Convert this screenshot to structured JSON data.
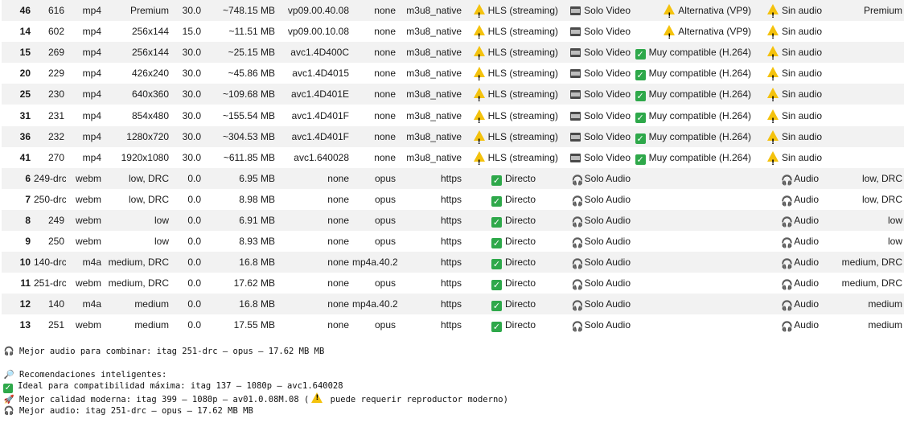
{
  "rows": [
    {
      "num": "46",
      "itag": "616",
      "ext": "mp4",
      "res": "Premium",
      "fps": "30.0",
      "size": "~748.15 MB",
      "vcodec": "vp09.00.40.08",
      "acodec": "none",
      "proto": "m3u8_native",
      "prot_icon": "warning",
      "prot": "HLS (streaming)",
      "type_icon": "film",
      "type": "Solo Video",
      "compat_icon": "warning",
      "compat": "Alternativa (VP9)",
      "audio_icon": "warning",
      "audio": "Sin audio",
      "note": "Premium"
    },
    {
      "num": "14",
      "itag": "602",
      "ext": "mp4",
      "res": "256x144",
      "fps": "15.0",
      "size": "~11.51 MB",
      "vcodec": "vp09.00.10.08",
      "acodec": "none",
      "proto": "m3u8_native",
      "prot_icon": "warning",
      "prot": "HLS (streaming)",
      "type_icon": "film",
      "type": "Solo Video",
      "compat_icon": "warning",
      "compat": "Alternativa (VP9)",
      "audio_icon": "warning",
      "audio": "Sin audio",
      "note": ""
    },
    {
      "num": "15",
      "itag": "269",
      "ext": "mp4",
      "res": "256x144",
      "fps": "30.0",
      "size": "~25.15 MB",
      "vcodec": "avc1.4D400C",
      "acodec": "none",
      "proto": "m3u8_native",
      "prot_icon": "warning",
      "prot": "HLS (streaming)",
      "type_icon": "film",
      "type": "Solo Video",
      "compat_icon": "check",
      "compat": "Muy compatible (H.264)",
      "audio_icon": "warning",
      "audio": "Sin audio",
      "note": ""
    },
    {
      "num": "20",
      "itag": "229",
      "ext": "mp4",
      "res": "426x240",
      "fps": "30.0",
      "size": "~45.86 MB",
      "vcodec": "avc1.4D4015",
      "acodec": "none",
      "proto": "m3u8_native",
      "prot_icon": "warning",
      "prot": "HLS (streaming)",
      "type_icon": "film",
      "type": "Solo Video",
      "compat_icon": "check",
      "compat": "Muy compatible (H.264)",
      "audio_icon": "warning",
      "audio": "Sin audio",
      "note": ""
    },
    {
      "num": "25",
      "itag": "230",
      "ext": "mp4",
      "res": "640x360",
      "fps": "30.0",
      "size": "~109.68 MB",
      "vcodec": "avc1.4D401E",
      "acodec": "none",
      "proto": "m3u8_native",
      "prot_icon": "warning",
      "prot": "HLS (streaming)",
      "type_icon": "film",
      "type": "Solo Video",
      "compat_icon": "check",
      "compat": "Muy compatible (H.264)",
      "audio_icon": "warning",
      "audio": "Sin audio",
      "note": ""
    },
    {
      "num": "31",
      "itag": "231",
      "ext": "mp4",
      "res": "854x480",
      "fps": "30.0",
      "size": "~155.54 MB",
      "vcodec": "avc1.4D401F",
      "acodec": "none",
      "proto": "m3u8_native",
      "prot_icon": "warning",
      "prot": "HLS (streaming)",
      "type_icon": "film",
      "type": "Solo Video",
      "compat_icon": "check",
      "compat": "Muy compatible (H.264)",
      "audio_icon": "warning",
      "audio": "Sin audio",
      "note": ""
    },
    {
      "num": "36",
      "itag": "232",
      "ext": "mp4",
      "res": "1280x720",
      "fps": "30.0",
      "size": "~304.53 MB",
      "vcodec": "avc1.4D401F",
      "acodec": "none",
      "proto": "m3u8_native",
      "prot_icon": "warning",
      "prot": "HLS (streaming)",
      "type_icon": "film",
      "type": "Solo Video",
      "compat_icon": "check",
      "compat": "Muy compatible (H.264)",
      "audio_icon": "warning",
      "audio": "Sin audio",
      "note": ""
    },
    {
      "num": "41",
      "itag": "270",
      "ext": "mp4",
      "res": "1920x1080",
      "fps": "30.0",
      "size": "~611.85 MB",
      "vcodec": "avc1.640028",
      "acodec": "none",
      "proto": "m3u8_native",
      "prot_icon": "warning",
      "prot": "HLS (streaming)",
      "type_icon": "film",
      "type": "Solo Video",
      "compat_icon": "check",
      "compat": "Muy compatible (H.264)",
      "audio_icon": "warning",
      "audio": "Sin audio",
      "note": ""
    },
    {
      "num": "6",
      "itag": "249-drc",
      "ext": "webm",
      "res": "low, DRC",
      "fps": "0.0",
      "size": "6.95 MB",
      "vcodec": "none",
      "acodec": "opus",
      "proto": "https",
      "prot_icon": "check",
      "prot": "Directo",
      "type_icon": "headphones",
      "type": "Solo Audio",
      "compat_icon": "",
      "compat": "",
      "audio_icon": "headphones",
      "audio": "Audio",
      "note": "low, DRC"
    },
    {
      "num": "7",
      "itag": "250-drc",
      "ext": "webm",
      "res": "low, DRC",
      "fps": "0.0",
      "size": "8.98 MB",
      "vcodec": "none",
      "acodec": "opus",
      "proto": "https",
      "prot_icon": "check",
      "prot": "Directo",
      "type_icon": "headphones",
      "type": "Solo Audio",
      "compat_icon": "",
      "compat": "",
      "audio_icon": "headphones",
      "audio": "Audio",
      "note": "low, DRC"
    },
    {
      "num": "8",
      "itag": "249",
      "ext": "webm",
      "res": "low",
      "fps": "0.0",
      "size": "6.91 MB",
      "vcodec": "none",
      "acodec": "opus",
      "proto": "https",
      "prot_icon": "check",
      "prot": "Directo",
      "type_icon": "headphones",
      "type": "Solo Audio",
      "compat_icon": "",
      "compat": "",
      "audio_icon": "headphones",
      "audio": "Audio",
      "note": "low"
    },
    {
      "num": "9",
      "itag": "250",
      "ext": "webm",
      "res": "low",
      "fps": "0.0",
      "size": "8.93 MB",
      "vcodec": "none",
      "acodec": "opus",
      "proto": "https",
      "prot_icon": "check",
      "prot": "Directo",
      "type_icon": "headphones",
      "type": "Solo Audio",
      "compat_icon": "",
      "compat": "",
      "audio_icon": "headphones",
      "audio": "Audio",
      "note": "low"
    },
    {
      "num": "10",
      "itag": "140-drc",
      "ext": "m4a",
      "res": "medium, DRC",
      "fps": "0.0",
      "size": "16.8 MB",
      "vcodec": "none",
      "acodec": "mp4a.40.2",
      "proto": "https",
      "prot_icon": "check",
      "prot": "Directo",
      "type_icon": "headphones",
      "type": "Solo Audio",
      "compat_icon": "",
      "compat": "",
      "audio_icon": "headphones",
      "audio": "Audio",
      "note": "medium, DRC"
    },
    {
      "num": "11",
      "itag": "251-drc",
      "ext": "webm",
      "res": "medium, DRC",
      "fps": "0.0",
      "size": "17.62 MB",
      "vcodec": "none",
      "acodec": "opus",
      "proto": "https",
      "prot_icon": "check",
      "prot": "Directo",
      "type_icon": "headphones",
      "type": "Solo Audio",
      "compat_icon": "",
      "compat": "",
      "audio_icon": "headphones",
      "audio": "Audio",
      "note": "medium, DRC"
    },
    {
      "num": "12",
      "itag": "140",
      "ext": "m4a",
      "res": "medium",
      "fps": "0.0",
      "size": "16.8 MB",
      "vcodec": "none",
      "acodec": "mp4a.40.2",
      "proto": "https",
      "prot_icon": "check",
      "prot": "Directo",
      "type_icon": "headphones",
      "type": "Solo Audio",
      "compat_icon": "",
      "compat": "",
      "audio_icon": "headphones",
      "audio": "Audio",
      "note": "medium"
    },
    {
      "num": "13",
      "itag": "251",
      "ext": "webm",
      "res": "medium",
      "fps": "0.0",
      "size": "17.55 MB",
      "vcodec": "none",
      "acodec": "opus",
      "proto": "https",
      "prot_icon": "check",
      "prot": "Directo",
      "type_icon": "headphones",
      "type": "Solo Audio",
      "compat_icon": "",
      "compat": "",
      "audio_icon": "headphones",
      "audio": "Audio",
      "note": "medium"
    }
  ],
  "footer": {
    "best_audio_icon": "headphones-icon",
    "best_audio": "Mejor audio para combinar: itag 251-drc — opus — 17.62 MB MB",
    "recs_icon": "magnifier-icon",
    "recs_title": "Recomendaciones inteligentes:",
    "rec_compat_icon": "check-icon",
    "rec_compat": "Ideal para compatibilidad máxima: itag 137 — 1080p — avc1.640028",
    "rec_modern_icon": "rocket-icon",
    "rec_modern_a": "Mejor calidad moderna: itag 399 — 1080p — av01.0.08M.08 (",
    "rec_modern_b": " puede requerir reproductor moderno)",
    "rec_audio_icon": "headphones-icon",
    "rec_audio": "Mejor audio: itag 251-drc — opus — 17.62 MB MB"
  },
  "colors": {
    "row_alt": "#f2f2f2",
    "check": "#2ea84a",
    "warning": "#f4c20d"
  }
}
